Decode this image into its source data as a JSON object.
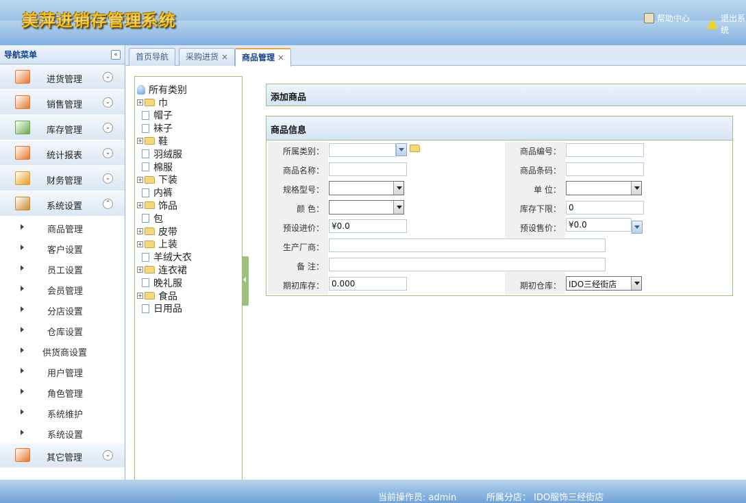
{
  "header": {
    "logo_text": "美萍进销存管理系统",
    "help_label": "帮助中心",
    "exit_label": "退出系统"
  },
  "nav": {
    "title": "导航菜单",
    "collapse_symbol": "«",
    "groups": [
      {
        "label": "进货管理",
        "icon": "purchase-icon",
        "color": "#e8762a"
      },
      {
        "label": "销售管理",
        "icon": "sales-icon",
        "color": "#e8762a"
      },
      {
        "label": "库存管理",
        "icon": "inventory-icon",
        "color": "#6aa84f"
      },
      {
        "label": "统计报表",
        "icon": "report-icon",
        "color": "#e8762a"
      },
      {
        "label": "财务管理",
        "icon": "finance-icon",
        "color": "#e69a1e"
      },
      {
        "label": "系统设置",
        "icon": "clock-icon",
        "color": "#c98a2a"
      }
    ],
    "system_items": [
      "商品管理",
      "客户设置",
      "员工设置",
      "会员管理",
      "分店设置",
      "仓库设置",
      "供货商设置",
      "用户管理",
      "角色管理",
      "系统维护",
      "系统设置"
    ],
    "other_group": {
      "label": "其它管理",
      "icon": "other-icon",
      "color": "#e8762a"
    }
  },
  "tabs": [
    {
      "label": "首页导航",
      "closable": false
    },
    {
      "label": "采购进货",
      "closable": true
    },
    {
      "label": "商品管理",
      "closable": true,
      "active": true
    }
  ],
  "tab_close_symbol": "×",
  "tree": {
    "root": "所有类别",
    "nodes": [
      {
        "label": "巾",
        "type": "folder"
      },
      {
        "label": "帽子",
        "type": "leaf"
      },
      {
        "label": "袜子",
        "type": "leaf"
      },
      {
        "label": "鞋",
        "type": "folder"
      },
      {
        "label": "羽绒服",
        "type": "leaf"
      },
      {
        "label": "棉服",
        "type": "leaf"
      },
      {
        "label": "下装",
        "type": "folder"
      },
      {
        "label": "内裤",
        "type": "leaf"
      },
      {
        "label": "饰品",
        "type": "folder"
      },
      {
        "label": "包",
        "type": "leaf"
      },
      {
        "label": "皮带",
        "type": "folder"
      },
      {
        "label": "上装",
        "type": "folder"
      },
      {
        "label": "羊绒大衣",
        "type": "leaf"
      },
      {
        "label": "连衣裙",
        "type": "folder"
      },
      {
        "label": "晚礼服",
        "type": "leaf"
      },
      {
        "label": "食品",
        "type": "folder"
      },
      {
        "label": "日用品",
        "type": "leaf"
      }
    ]
  },
  "panels": {
    "add_title": "添加商品",
    "info_title": "商品信息"
  },
  "form": {
    "category_label": "所属类别：",
    "code_label": "商品编号：",
    "name_label": "商品名称：",
    "barcode_label": "商品条码：",
    "spec_label": "规格型号：",
    "unit_label": "单 位：",
    "color_label": "颜 色：",
    "stock_min_label": "库存下限：",
    "stock_min_value": "0",
    "buy_price_label": "预设进价：",
    "buy_price_value": "¥0.0",
    "sell_price_label": "预设售价：",
    "sell_price_value": "¥0.0",
    "maker_label": "生产厂商：",
    "remark_label": "备 注：",
    "init_stock_label": "期初库存：",
    "init_stock_value": "0.000",
    "init_warehouse_label": "期初仓库：",
    "init_warehouse_value": "IDO三经街店"
  },
  "footer": {
    "operator": "当前操作员:  admin",
    "branch": "所属分店：  IDO服饰三经街店"
  }
}
